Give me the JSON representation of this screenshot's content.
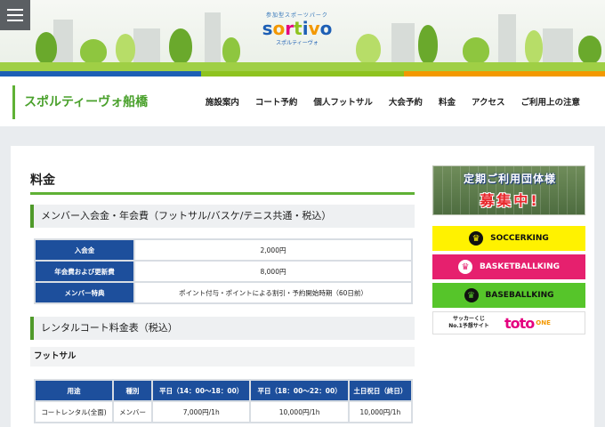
{
  "hero": {
    "logo_tagline": "参加型スポーツパーク",
    "logo_word": [
      "s",
      "o",
      "r",
      "t",
      "i",
      "v"
    ],
    "logo_word_tail": "o",
    "logo_sub": "スポルティーヴォ",
    "bar_colors": [
      "#1d5fb5",
      "#8ec31f",
      "#f39800"
    ]
  },
  "header": {
    "site_title": "スポルティーヴォ船橋",
    "nav": [
      "施設案内",
      "コート予約",
      "個人フットサル",
      "大会予約",
      "料金",
      "アクセス",
      "ご利用上の注意"
    ]
  },
  "main": {
    "page_title": "料金",
    "section1_title": "メンバー入会金・年会費（フットサル/バスケ/テニス共通・税込）",
    "fees": [
      {
        "label": "入会金",
        "value": "2,000円"
      },
      {
        "label": "年会費および更新費",
        "value": "8,000円"
      },
      {
        "label": "メンバー特典",
        "value": "ポイント付与・ポイントによる割引・予約開始時期（60日前）"
      }
    ],
    "section2_title": "レンタルコート料金表（税込）",
    "sub_title": "フットサル",
    "rental_headers": [
      "用途",
      "種別",
      "平日（14：00〜18：00）",
      "平日（18：00〜22：00）",
      "土日祝日（終日）"
    ],
    "rental_rows": [
      [
        "コートレンタル(全面)",
        "メンバー",
        "7,000円/1h",
        "10,000円/1h",
        "10,000円/1h"
      ]
    ]
  },
  "sidebar": {
    "recruit_line1": "定期ご利用団体様",
    "recruit_line2": "募集中!",
    "soccer": "SOCCERKING",
    "basket": "BASKETBALLKING",
    "base": "BASEBALLKING",
    "toto_text": "サッカーくじ",
    "toto_text2": "No.1予想サイト",
    "toto_brand": "toto",
    "toto_one": "ONE"
  }
}
